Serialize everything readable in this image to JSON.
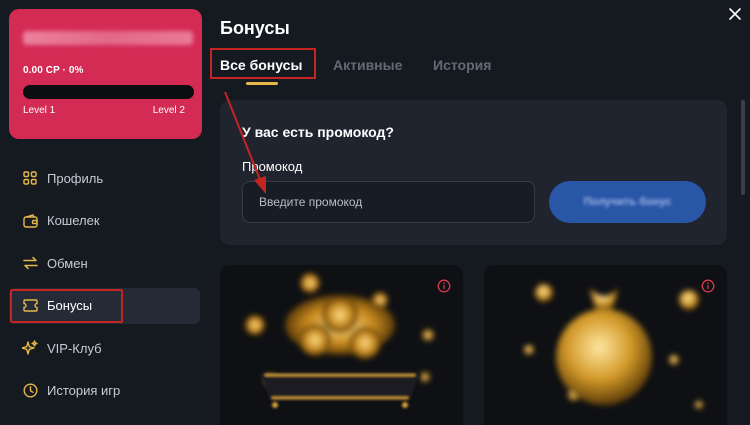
{
  "sidebar": {
    "level_card": {
      "cp_text": "0.00 CP · 0%",
      "level_from": "Level 1",
      "level_to": "Level 2",
      "progress": 0
    },
    "items": [
      {
        "label": "Профиль",
        "icon": "profile-grid-icon"
      },
      {
        "label": "Кошелек",
        "icon": "wallet-icon"
      },
      {
        "label": "Обмен",
        "icon": "exchange-icon"
      },
      {
        "label": "Бонусы",
        "icon": "ticket-icon",
        "active": true
      },
      {
        "label": "VIP-Клуб",
        "icon": "sparkle-icon"
      },
      {
        "label": "История игр",
        "icon": "history-icon"
      }
    ]
  },
  "main": {
    "title": "Бонусы",
    "tabs": [
      {
        "label": "Все бонусы",
        "active": true
      },
      {
        "label": "Активные"
      },
      {
        "label": "История"
      }
    ],
    "promo": {
      "title": "У вас есть промокод?",
      "label": "Промокод",
      "placeholder": "Введите промокод",
      "button": "Получить бонус"
    }
  },
  "colors": {
    "background": "#151920",
    "level_card": "#d42b55",
    "card": "#1f242e",
    "accent_gold": "#e6b84a",
    "button_blue": "#2a56a8",
    "annotation_red": "#c62420"
  }
}
